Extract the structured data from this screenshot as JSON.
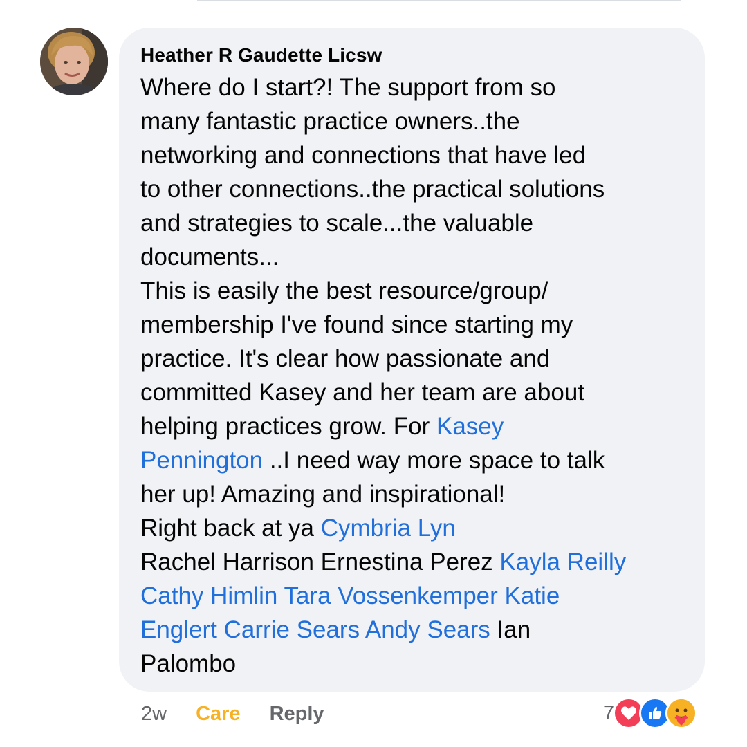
{
  "comment": {
    "author": "Heather R Gaudette Licsw",
    "lines": [
      [
        {
          "text": "Where do I start?! The support from so",
          "mention": false
        }
      ],
      [
        {
          "text": "many fantastic practice owners..the",
          "mention": false
        }
      ],
      [
        {
          "text": "networking and connections that have led",
          "mention": false
        }
      ],
      [
        {
          "text": "to other connections..the practical solutions",
          "mention": false
        }
      ],
      [
        {
          "text": "and strategies to scale...the valuable",
          "mention": false
        }
      ],
      [
        {
          "text": "documents...",
          "mention": false
        }
      ],
      [
        {
          "text": "This is easily the best resource/group/",
          "mention": false
        }
      ],
      [
        {
          "text": "membership I've found since starting my",
          "mention": false
        }
      ],
      [
        {
          "text": "practice. It's clear how passionate and",
          "mention": false
        }
      ],
      [
        {
          "text": "committed Kasey and her team are about",
          "mention": false
        }
      ],
      [
        {
          "text": "helping practices grow. For ",
          "mention": false
        },
        {
          "text": "Kasey",
          "mention": true
        }
      ],
      [
        {
          "text": "Pennington",
          "mention": true
        },
        {
          "text": " ..I need way more space to talk",
          "mention": false
        }
      ],
      [
        {
          "text": "her up! Amazing and inspirational!",
          "mention": false
        }
      ],
      [
        {
          "text": "Right back at ya ",
          "mention": false
        },
        {
          "text": "Cymbria Lyn",
          "mention": true
        }
      ],
      [
        {
          "text": "Rachel Harrison Ernestina Perez ",
          "mention": false
        },
        {
          "text": "Kayla Reilly",
          "mention": true
        }
      ],
      [
        {
          "text": "Cathy Himlin Tara Vossenkemper Katie",
          "mention": true
        }
      ],
      [
        {
          "text": "Englert Carrie Sears Andy Sears",
          "mention": true
        },
        {
          "text": " Ian",
          "mention": false
        }
      ],
      [
        {
          "text": "Palombo",
          "mention": false
        }
      ]
    ]
  },
  "footer": {
    "time": "2w",
    "reaction_label": "Care",
    "reply_label": "Reply",
    "reaction_count": "7"
  },
  "reactions": [
    {
      "icon": "love-reaction-icon",
      "color": "#f33e58"
    },
    {
      "icon": "like-reaction-icon",
      "color": "#1877f2"
    },
    {
      "icon": "care-reaction-icon",
      "color": "#f7b125"
    }
  ],
  "colors": {
    "mention": "#216fdb",
    "bubble": "#f0f2f5",
    "care": "#f7b125",
    "meta": "#65676b"
  }
}
